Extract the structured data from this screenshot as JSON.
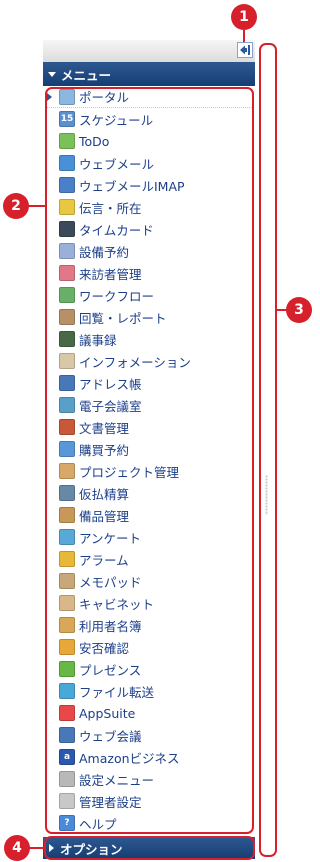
{
  "menu_header": {
    "label": "メニュー"
  },
  "options": {
    "label": "オプション"
  },
  "callouts": [
    "1",
    "2",
    "3",
    "4"
  ],
  "menu_items": [
    {
      "label": "ポータル",
      "icon": "portal-icon",
      "color": "#8ab8e0"
    },
    {
      "label": "スケジュール",
      "icon": "calendar-icon",
      "color": "#5a8fd0",
      "glyph": "15"
    },
    {
      "label": "ToDo",
      "icon": "todo-icon",
      "color": "#7cc05a"
    },
    {
      "label": "ウェブメール",
      "icon": "webmail-icon",
      "color": "#4a90d8"
    },
    {
      "label": "ウェブメールIMAP",
      "icon": "webmail-imap-icon",
      "color": "#4a80c8"
    },
    {
      "label": "伝言・所在",
      "icon": "message-icon",
      "color": "#e8c840"
    },
    {
      "label": "タイムカード",
      "icon": "timecard-icon",
      "color": "#3a4a5a"
    },
    {
      "label": "設備予約",
      "icon": "facility-icon",
      "color": "#9ab0d8"
    },
    {
      "label": "来訪者管理",
      "icon": "visitor-icon",
      "color": "#e07888"
    },
    {
      "label": "ワークフロー",
      "icon": "workflow-icon",
      "color": "#68b068"
    },
    {
      "label": "回覧・レポート",
      "icon": "circular-icon",
      "color": "#b89068"
    },
    {
      "label": "議事録",
      "icon": "minutes-icon",
      "color": "#486848"
    },
    {
      "label": "インフォメーション",
      "icon": "information-icon",
      "color": "#d8c8a8"
    },
    {
      "label": "アドレス帳",
      "icon": "address-book-icon",
      "color": "#4878b8"
    },
    {
      "label": "電子会議室",
      "icon": "e-conference-icon",
      "color": "#58a0c8"
    },
    {
      "label": "文書管理",
      "icon": "document-icon",
      "color": "#c85838"
    },
    {
      "label": "購買予約",
      "icon": "purchase-icon",
      "color": "#5898d8"
    },
    {
      "label": "プロジェクト管理",
      "icon": "project-icon",
      "color": "#d8a868"
    },
    {
      "label": "仮払精算",
      "icon": "expense-icon",
      "color": "#6888a8"
    },
    {
      "label": "備品管理",
      "icon": "equipment-icon",
      "color": "#c89858"
    },
    {
      "label": "アンケート",
      "icon": "survey-icon",
      "color": "#58a8d8"
    },
    {
      "label": "アラーム",
      "icon": "alarm-icon",
      "color": "#e8b838"
    },
    {
      "label": "メモパッド",
      "icon": "memo-icon",
      "color": "#c8a878"
    },
    {
      "label": "キャビネット",
      "icon": "cabinet-icon",
      "color": "#d8b888"
    },
    {
      "label": "利用者名簿",
      "icon": "user-directory-icon",
      "color": "#d8a858"
    },
    {
      "label": "安否確認",
      "icon": "safety-icon",
      "color": "#e8a838"
    },
    {
      "label": "プレゼンス",
      "icon": "presence-icon",
      "color": "#68b848"
    },
    {
      "label": "ファイル転送",
      "icon": "file-transfer-icon",
      "color": "#48a8d8"
    },
    {
      "label": "AppSuite",
      "icon": "appsuite-icon",
      "color": "#e84848"
    },
    {
      "label": "ウェブ会議",
      "icon": "web-meeting-icon",
      "color": "#4878b8"
    },
    {
      "label": "Amazonビジネス",
      "icon": "amazon-icon",
      "color": "#2a5ab0",
      "glyph": "a"
    },
    {
      "label": "設定メニュー",
      "icon": "settings-menu-icon",
      "color": "#b8b8b8"
    },
    {
      "label": "管理者設定",
      "icon": "admin-settings-icon",
      "color": "#c8c8c8"
    },
    {
      "label": "ヘルプ",
      "icon": "help-icon",
      "color": "#4a8ad8",
      "glyph": "?"
    }
  ]
}
